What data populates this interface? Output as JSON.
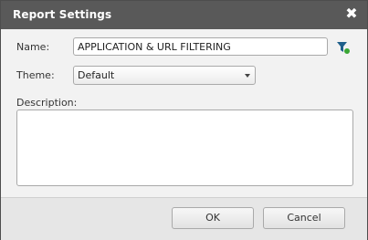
{
  "dialog": {
    "title": "Report Settings",
    "close_icon": "close-icon"
  },
  "form": {
    "name_label": "Name:",
    "name_value": "APPLICATION & URL FILTERING",
    "filter_icon": "filter-icon",
    "theme_label": "Theme:",
    "theme_value": "Default",
    "description_label": "Description:",
    "description_value": ""
  },
  "footer": {
    "ok_label": "OK",
    "cancel_label": "Cancel"
  },
  "colors": {
    "titlebar": "#595959",
    "body": "#f2f2f2",
    "footer": "#e6e6e6",
    "filter_funnel": "#1f5f8b",
    "filter_dot": "#3aa635"
  }
}
